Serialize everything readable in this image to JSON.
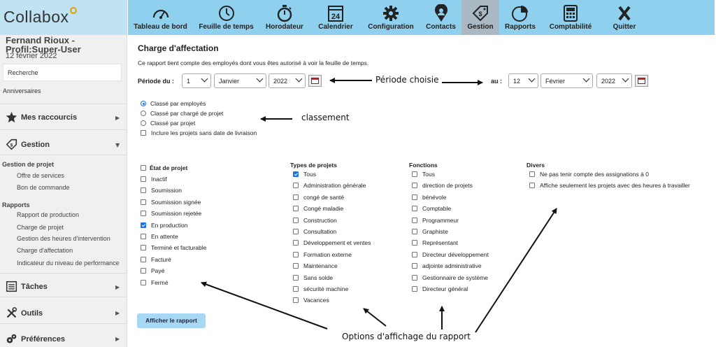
{
  "app": {
    "logo": "Collabox"
  },
  "nav": [
    {
      "label": "Tableau de bord",
      "icon": "dashboard-gauge-icon"
    },
    {
      "label": "Feuille de temps",
      "icon": "clock-icon"
    },
    {
      "label": "Horodateur",
      "icon": "stopwatch-icon"
    },
    {
      "label": "Calendrier",
      "icon": "calendar-icon",
      "day": "24"
    },
    {
      "label": "Configuration",
      "icon": "gear-icon"
    },
    {
      "label": "Contacts",
      "icon": "person-pin-icon"
    },
    {
      "label": "Gestion",
      "icon": "money-tag-icon",
      "active": true
    },
    {
      "label": "Rapports",
      "icon": "pie-chart-icon"
    },
    {
      "label": "Comptabilité",
      "icon": "calculator-icon"
    },
    {
      "label": "Quitter",
      "icon": "close-x-icon"
    }
  ],
  "sidebar": {
    "user_line1": "Fernand Rioux -",
    "user_line2": "Profil:Super-User",
    "date": "12 février 2022",
    "search_placeholder": "Recherche",
    "anniversaires": "Anniversaires",
    "shortcuts": "Mes raccourcis",
    "gestion": "Gestion",
    "group_projet": "Gestion de projet",
    "projet_links": [
      "Offre de services",
      "Bon de commande"
    ],
    "group_rapports": "Rapports",
    "rapport_links": [
      "Rapport de production",
      "Charge de projet",
      "Gestion des heures d'intervention",
      "Charge d'affectation",
      "Indicateur du niveau de performance"
    ],
    "taches": "Tâches",
    "outils": "Outils",
    "preferences": "Préférences"
  },
  "main": {
    "title": "Charge d'affectation",
    "intro": "Ce rapport tient compte des employés dont vous êtes autorisé à voir la feuille de temps.",
    "period_from_label": "Période du :",
    "period_to_label": "au :",
    "from": {
      "day": "1",
      "month": "Janvier",
      "year": "2022"
    },
    "to": {
      "day": "12",
      "month": "Février",
      "year": "2022"
    },
    "sort_options": [
      {
        "label": "Classé par employés",
        "checked": true
      },
      {
        "label": "Classé par chargé de projet",
        "checked": false
      },
      {
        "label": "Classé par projet",
        "checked": false
      }
    ],
    "include_no_delivery": {
      "label": "Inclure les projets sans date de livraison",
      "checked": false
    },
    "etat_title": "État de projet",
    "etat": [
      {
        "label": "Inactif",
        "checked": false
      },
      {
        "label": "Soumission",
        "checked": false
      },
      {
        "label": "Soumission signée",
        "checked": false
      },
      {
        "label": "Soumission rejetée",
        "checked": false
      },
      {
        "label": "En production",
        "checked": true
      },
      {
        "label": "En attente",
        "checked": false
      },
      {
        "label": "Terminé et facturable",
        "checked": false
      },
      {
        "label": "Facturé",
        "checked": false
      },
      {
        "label": "Payé",
        "checked": false
      },
      {
        "label": "Fermé",
        "checked": false
      }
    ],
    "types_title": "Types de projets",
    "types": [
      {
        "label": "Tous",
        "checked": true
      },
      {
        "label": "Administration générale",
        "checked": false
      },
      {
        "label": "congé de santé",
        "checked": false
      },
      {
        "label": "Congé maladie",
        "checked": false
      },
      {
        "label": "Construction",
        "checked": false
      },
      {
        "label": "Consultation",
        "checked": false
      },
      {
        "label": "Développement et ventes",
        "checked": false
      },
      {
        "label": "Formation externe",
        "checked": false
      },
      {
        "label": "Maintenance",
        "checked": false
      },
      {
        "label": "Sans solde",
        "checked": false
      },
      {
        "label": "sécurité machine",
        "checked": false
      },
      {
        "label": "Vacances",
        "checked": false
      }
    ],
    "fonctions_title": "Fonctions",
    "fonctions": [
      {
        "label": "Tous",
        "checked": false
      },
      {
        "label": "direction de projets",
        "checked": false
      },
      {
        "label": "bénévole",
        "checked": false
      },
      {
        "label": "Comptable",
        "checked": false
      },
      {
        "label": "Programmeur",
        "checked": false
      },
      {
        "label": "Graphiste",
        "checked": false
      },
      {
        "label": "Représentant",
        "checked": false
      },
      {
        "label": "Directeur développement",
        "checked": false
      },
      {
        "label": "adjointe administrative",
        "checked": false
      },
      {
        "label": "Gestionnaire de système",
        "checked": false
      },
      {
        "label": "Directeur général",
        "checked": false
      }
    ],
    "divers_title": "Divers",
    "divers": [
      {
        "label": "Ne pas tenir compte des assignations à 0",
        "checked": false
      },
      {
        "label": "Affiche seulement les projets avec des heures à travailler",
        "checked": false
      }
    ],
    "submit": "Afficher le rapport"
  },
  "annotations": {
    "period": "Période choisie",
    "sort": "classement",
    "options": "Options d'affichage du rapport"
  }
}
